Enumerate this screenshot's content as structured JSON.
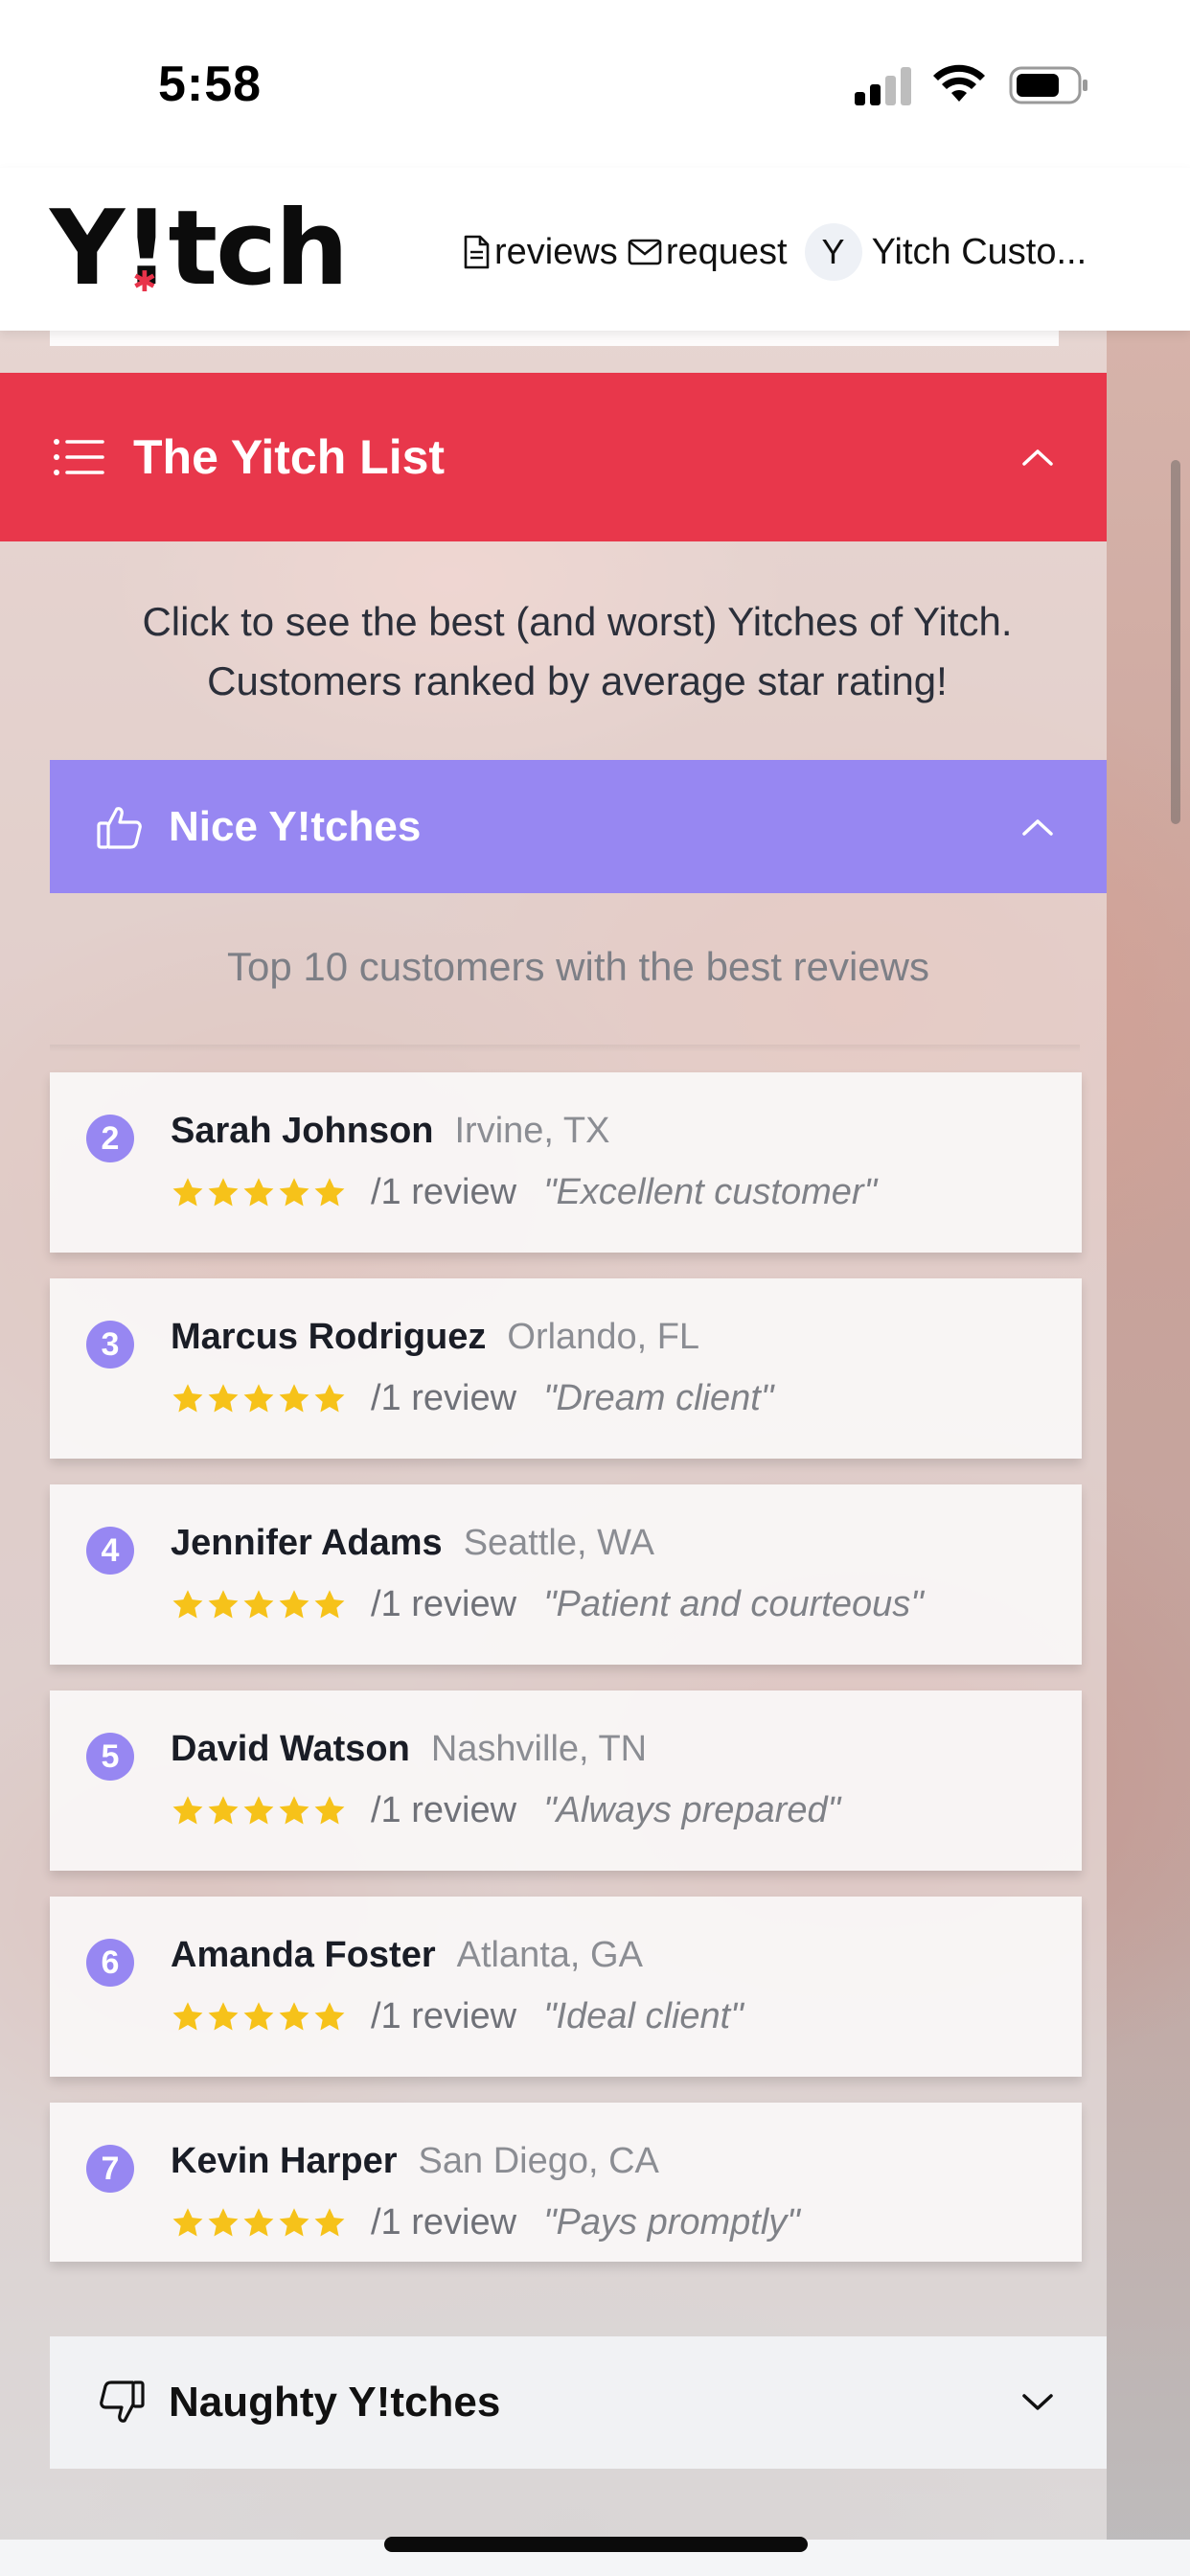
{
  "status_bar": {
    "time": "5:58"
  },
  "header": {
    "logo": {
      "y": "Y",
      "bang": "!",
      "rest": "tch"
    },
    "nav": [
      {
        "label": "reviews",
        "icon": "document-icon"
      },
      {
        "label": "request",
        "icon": "mail-icon"
      }
    ],
    "avatar_initial": "Y",
    "user_name": "Yitch Custo..."
  },
  "yitch_list": {
    "title": "The Yitch List",
    "intro_line1": "Click to see the best (and worst) Yitches of Yitch.",
    "intro_line2": "Customers ranked by average star rating!"
  },
  "nice": {
    "title": "Nice Y!tches",
    "subtitle": "Top 10 customers with the best reviews",
    "customers": [
      {
        "rank": "2",
        "name": "Sarah Johnson",
        "location": "Irvine, TX",
        "rating": 5,
        "count": "/1 review",
        "quote": "\"Excellent customer\""
      },
      {
        "rank": "3",
        "name": "Marcus Rodriguez",
        "location": "Orlando, FL",
        "rating": 5,
        "count": "/1 review",
        "quote": "\"Dream client\""
      },
      {
        "rank": "4",
        "name": "Jennifer Adams",
        "location": "Seattle, WA",
        "rating": 5,
        "count": "/1 review",
        "quote": "\"Patient and courteous\""
      },
      {
        "rank": "5",
        "name": "David Watson",
        "location": "Nashville, TN",
        "rating": 5,
        "count": "/1 review",
        "quote": "\"Always prepared\""
      },
      {
        "rank": "6",
        "name": "Amanda Foster",
        "location": "Atlanta, GA",
        "rating": 5,
        "count": "/1 review",
        "quote": "\"Ideal client\""
      },
      {
        "rank": "7",
        "name": "Kevin Harper",
        "location": "San Diego, CA",
        "rating": 5,
        "count": "/1 review",
        "quote": "\"Pays promptly\""
      }
    ]
  },
  "naughty": {
    "title": "Naughty Y!tches"
  },
  "colors": {
    "accent_red": "#e8374b",
    "accent_purple": "#9787f2",
    "star_yellow": "#f6c21a",
    "logo_star": "#e8334a"
  }
}
